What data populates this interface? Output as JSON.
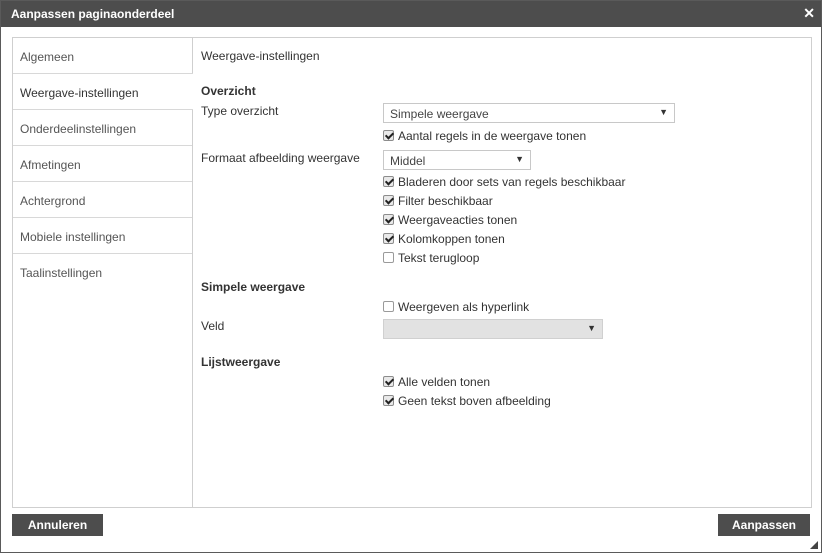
{
  "window": {
    "title": "Aanpassen paginaonderdeel",
    "close_glyph": "✕"
  },
  "sidebar": {
    "items": [
      {
        "label": "Algemeen"
      },
      {
        "label": "Weergave-instellingen"
      },
      {
        "label": "Onderdeelinstellingen"
      },
      {
        "label": "Afmetingen"
      },
      {
        "label": "Achtergrond"
      },
      {
        "label": "Mobiele instellingen"
      },
      {
        "label": "Taalinstellingen"
      }
    ],
    "active": "Weergave-instellingen"
  },
  "main": {
    "heading": "Weergave-instellingen",
    "overzicht": {
      "title": "Overzicht",
      "type_label": "Type overzicht",
      "type_value": "Simpele weergave",
      "show_rows": {
        "label": "Aantal regels in de weergave tonen",
        "checked": true
      },
      "format_label": "Formaat afbeelding weergave",
      "format_value": "Middel",
      "options": [
        {
          "label": "Bladeren door sets van regels beschikbaar",
          "checked": true
        },
        {
          "label": "Filter beschikbaar",
          "checked": true
        },
        {
          "label": "Weergaveacties tonen",
          "checked": true
        },
        {
          "label": "Kolomkoppen tonen",
          "checked": true
        },
        {
          "label": "Tekst terugloop",
          "checked": false
        }
      ]
    },
    "simpele": {
      "title": "Simpele weergave",
      "hyperlink": {
        "label": "Weergeven als hyperlink",
        "checked": false
      },
      "veld_label": "Veld",
      "veld_value": ""
    },
    "lijst": {
      "title": "Lijstweergave",
      "options": [
        {
          "label": "Alle velden tonen",
          "checked": true
        },
        {
          "label": "Geen tekst boven afbeelding",
          "checked": true
        }
      ]
    }
  },
  "footer": {
    "cancel_label": "Annuleren",
    "apply_label": "Aanpassen"
  },
  "icons": {
    "dropdown": "chevron-down-icon",
    "close": "close-icon",
    "checkbox": "check-icon"
  },
  "colors": {
    "titlebar": "#4d4d4d",
    "button": "#4d4d4d",
    "border": "#cfcfcf"
  }
}
